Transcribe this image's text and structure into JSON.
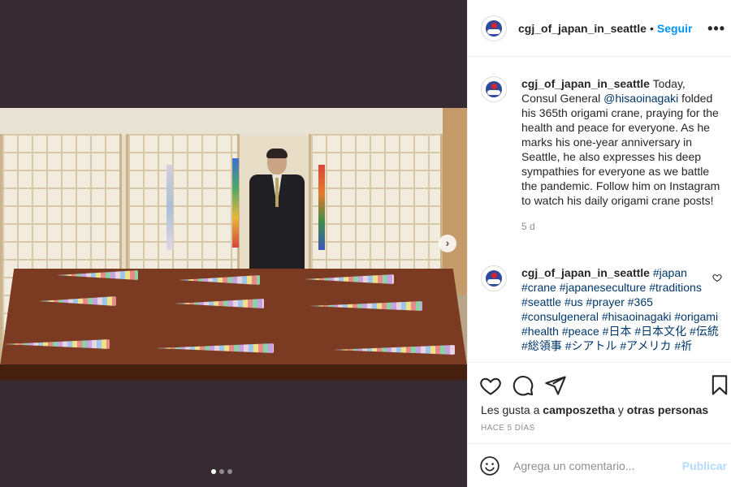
{
  "post": {
    "username": "cgj_of_japan_in_seattle",
    "separator": "•",
    "follow_label": "Seguir",
    "more_label": "•••",
    "next_label": "›",
    "slides": {
      "count": 3,
      "current": 1
    }
  },
  "caption": {
    "username": "cgj_of_japan_in_seattle",
    "text_before": " Today, Consul General ",
    "mention": "@hisaoinagaki",
    "text_after": " folded his 365th origami crane, praying for the health and peace for everyone. As he marks his one-year anniversary in Seattle, he also expresses his deep sympathies for everyone as we battle the pandemic. Follow him on Instagram to watch his daily origami crane posts!",
    "time": "5 d"
  },
  "hashtag_comment": {
    "username": "cgj_of_japan_in_seattle",
    "tags": [
      "#japan",
      "#crane",
      "#japaneseculture",
      "#traditions",
      "#seattle",
      "#us",
      "#prayer",
      "#365",
      "#consulgeneral",
      "#hisaoinagaki",
      "#origami",
      "#health",
      "#peace",
      "#日本",
      "#日本文化",
      "#伝統",
      "#総領事",
      "#シアトル",
      "#アメリカ",
      "#祈"
    ]
  },
  "likes": {
    "prefix": "Les gusta a ",
    "user": "camposzetha",
    "middle": " y ",
    "others": "otras personas"
  },
  "posted_ago": "HACE 5 DÍAS",
  "comment_box": {
    "placeholder": "Agrega un comentario...",
    "publish_label": "Publicar"
  },
  "colors": {
    "link": "#0095f6",
    "mention": "#00376b",
    "publish_disabled": "#b3dbff",
    "muted": "#8e8e8e",
    "media_bg": "#352b30"
  },
  "icons": [
    "heart-icon",
    "comment-icon",
    "share-icon",
    "bookmark-icon",
    "emoji-icon",
    "chevron-right-icon",
    "more-options-icon"
  ]
}
